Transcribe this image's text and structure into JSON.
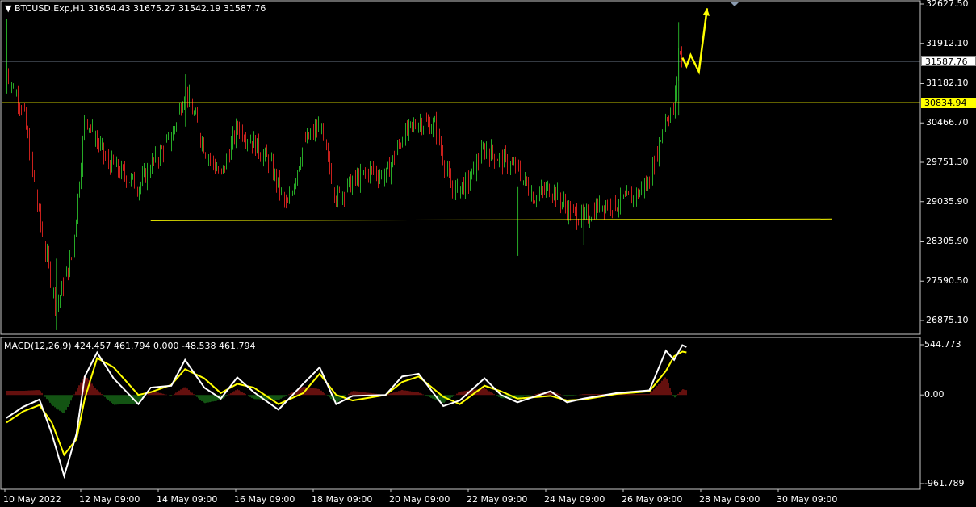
{
  "header": {
    "symbol_line": "BTCUSD.Exp,H1  31654.43 31675.27 31542.19 31587.76"
  },
  "price_axis": {
    "ticks": [
      "32627.50",
      "31912.10",
      "31182.10",
      "30466.70",
      "29751.30",
      "29035.90",
      "28305.90",
      "27590.50",
      "26875.10"
    ],
    "current_price": "31587.76",
    "level_price": "30834.94"
  },
  "macd_panel": {
    "title": "MACD(12,26,9) 424.457 461.794 0.000 -48.538 461.794",
    "ticks": [
      "544.773",
      "0.00",
      "-961.789"
    ]
  },
  "time_axis": {
    "labels": [
      "10 May 2022",
      "12 May 09:00",
      "14 May 09:00",
      "16 May 09:00",
      "18 May 09:00",
      "20 May 09:00",
      "22 May 09:00",
      "24 May 09:00",
      "26 May 09:00",
      "28 May 09:00",
      "30 May 09:00"
    ]
  },
  "colors": {
    "up_candle": "#26a826",
    "down_candle": "#c8201c",
    "macd_line": "#ffffff",
    "signal_line": "#ffff00",
    "current_price_line": "#8a9bb0",
    "level_line": "#ffff00",
    "arrow": "#ffff00",
    "grid_frame": "#c8c8c8"
  },
  "chart_data": [
    {
      "type": "candlestick",
      "title": "BTCUSD.Exp,H1",
      "ylim": [
        26600,
        32700
      ],
      "close_path": [
        {
          "x": "10 May 00:00",
          "y": 31400
        },
        {
          "x": "10 May 12:00",
          "y": 30700
        },
        {
          "x": "11 May 00:00",
          "y": 28700
        },
        {
          "x": "11 May 12:00",
          "y": 27100
        },
        {
          "x": "12 May 00:00",
          "y": 28100
        },
        {
          "x": "12 May 09:00",
          "y": 30600
        },
        {
          "x": "13 May 00:00",
          "y": 29800
        },
        {
          "x": "14 May 00:00",
          "y": 29300
        },
        {
          "x": "14 May 09:00",
          "y": 29700
        },
        {
          "x": "15 May 00:00",
          "y": 30200
        },
        {
          "x": "15 May 10:00",
          "y": 31100
        },
        {
          "x": "16 May 00:00",
          "y": 30000
        },
        {
          "x": "16 May 12:00",
          "y": 29500
        },
        {
          "x": "17 May 00:00",
          "y": 30400
        },
        {
          "x": "17 May 12:00",
          "y": 30100
        },
        {
          "x": "18 May 00:00",
          "y": 29700
        },
        {
          "x": "18 May 12:00",
          "y": 28900
        },
        {
          "x": "19 May 00:00",
          "y": 30100
        },
        {
          "x": "19 May 12:00",
          "y": 30400
        },
        {
          "x": "20 May 00:00",
          "y": 29100
        },
        {
          "x": "20 May 12:00",
          "y": 29400
        },
        {
          "x": "21 May 00:00",
          "y": 29600
        },
        {
          "x": "21 May 12:00",
          "y": 29500
        },
        {
          "x": "22 May 00:00",
          "y": 30200
        },
        {
          "x": "22 May 12:00",
          "y": 30500
        },
        {
          "x": "23 May 00:00",
          "y": 30400
        },
        {
          "x": "23 May 12:00",
          "y": 29200
        },
        {
          "x": "24 May 00:00",
          "y": 29400
        },
        {
          "x": "24 May 12:00",
          "y": 30000
        },
        {
          "x": "25 May 00:00",
          "y": 29800
        },
        {
          "x": "25 May 12:00",
          "y": 29600
        },
        {
          "x": "26 May 00:00",
          "y": 29100
        },
        {
          "x": "26 May 12:00",
          "y": 29300
        },
        {
          "x": "27 May 00:00",
          "y": 28900
        },
        {
          "x": "27 May 12:00",
          "y": 28700
        },
        {
          "x": "28 May 00:00",
          "y": 29000
        },
        {
          "x": "28 May 12:00",
          "y": 29000
        },
        {
          "x": "29 May 00:00",
          "y": 29100
        },
        {
          "x": "29 May 12:00",
          "y": 29400
        },
        {
          "x": "30 May 00:00",
          "y": 30600
        },
        {
          "x": "30 May 06:00",
          "y": 30700
        },
        {
          "x": "30 May 09:00",
          "y": 31800
        },
        {
          "x": "30 May 12:00",
          "y": 31587.76
        }
      ],
      "spikes": [
        {
          "x": "10 May 00:00",
          "high": 32350,
          "low": 31000
        },
        {
          "x": "11 May 12:00",
          "high": 28000,
          "low": 26700
        },
        {
          "x": "15 May 10:00",
          "high": 31350,
          "low": 30400
        },
        {
          "x": "25 May 12:00",
          "high": 29300,
          "low": 28050
        },
        {
          "x": "27 May 12:00",
          "high": 29000,
          "low": 28250
        },
        {
          "x": "30 May 09:00",
          "high": 32300,
          "low": 30600
        }
      ],
      "current_price": 31587.76,
      "horizontal_level": 30834.94,
      "support_trendline": [
        {
          "x": "14 May 09:00",
          "y": 28690
        },
        {
          "x": "31 May 09:00",
          "y": 28720
        }
      ],
      "projection_arrow": [
        {
          "x": "30 May 12:00",
          "y": 31650
        },
        {
          "x": "30 May 15:00",
          "y": 31500
        },
        {
          "x": "30 May 18:00",
          "y": 31700
        },
        {
          "x": "31 May 00:00",
          "y": 31400
        },
        {
          "x": "31 May 06:00",
          "y": 32550
        }
      ]
    },
    {
      "type": "macd",
      "title": "MACD(12,26,9)",
      "ylim": [
        -961.789,
        544.773
      ],
      "macd_line": [
        {
          "x": "10 May 00:00",
          "y": -250
        },
        {
          "x": "10 May 12:00",
          "y": -130
        },
        {
          "x": "11 May 00:00",
          "y": -50
        },
        {
          "x": "11 May 09:00",
          "y": -420
        },
        {
          "x": "11 May 18:00",
          "y": -880
        },
        {
          "x": "12 May 03:00",
          "y": -420
        },
        {
          "x": "12 May 09:00",
          "y": 200
        },
        {
          "x": "12 May 18:00",
          "y": 460
        },
        {
          "x": "13 May 06:00",
          "y": 180
        },
        {
          "x": "14 May 00:00",
          "y": -100
        },
        {
          "x": "14 May 09:00",
          "y": 80
        },
        {
          "x": "15 May 00:00",
          "y": 100
        },
        {
          "x": "15 May 10:00",
          "y": 380
        },
        {
          "x": "16 May 00:00",
          "y": 80
        },
        {
          "x": "16 May 12:00",
          "y": -40
        },
        {
          "x": "17 May 00:00",
          "y": 190
        },
        {
          "x": "17 May 12:00",
          "y": 30
        },
        {
          "x": "18 May 06:00",
          "y": -160
        },
        {
          "x": "19 May 00:00",
          "y": 120
        },
        {
          "x": "19 May 12:00",
          "y": 300
        },
        {
          "x": "20 May 00:00",
          "y": -100
        },
        {
          "x": "20 May 12:00",
          "y": -10
        },
        {
          "x": "21 May 12:00",
          "y": 0
        },
        {
          "x": "22 May 00:00",
          "y": 200
        },
        {
          "x": "22 May 12:00",
          "y": 230
        },
        {
          "x": "23 May 06:00",
          "y": -120
        },
        {
          "x": "23 May 18:00",
          "y": -60
        },
        {
          "x": "24 May 12:00",
          "y": 180
        },
        {
          "x": "25 May 00:00",
          "y": 0
        },
        {
          "x": "25 May 12:00",
          "y": -80
        },
        {
          "x": "26 May 12:00",
          "y": 40
        },
        {
          "x": "27 May 00:00",
          "y": -80
        },
        {
          "x": "27 May 12:00",
          "y": -40
        },
        {
          "x": "28 May 12:00",
          "y": 20
        },
        {
          "x": "29 May 12:00",
          "y": 50
        },
        {
          "x": "30 May 00:00",
          "y": 480
        },
        {
          "x": "30 May 06:00",
          "y": 380
        },
        {
          "x": "30 May 12:00",
          "y": 540
        },
        {
          "x": "30 May 15:00",
          "y": 520
        }
      ],
      "signal_line": [
        {
          "x": "10 May 00:00",
          "y": -300
        },
        {
          "x": "10 May 12:00",
          "y": -180
        },
        {
          "x": "11 May 00:00",
          "y": -110
        },
        {
          "x": "11 May 09:00",
          "y": -300
        },
        {
          "x": "11 May 18:00",
          "y": -650
        },
        {
          "x": "12 May 03:00",
          "y": -480
        },
        {
          "x": "12 May 09:00",
          "y": -40
        },
        {
          "x": "12 May 18:00",
          "y": 400
        },
        {
          "x": "13 May 06:00",
          "y": 300
        },
        {
          "x": "14 May 00:00",
          "y": 0
        },
        {
          "x": "14 May 09:00",
          "y": 30
        },
        {
          "x": "15 May 00:00",
          "y": 110
        },
        {
          "x": "15 May 10:00",
          "y": 280
        },
        {
          "x": "16 May 00:00",
          "y": 180
        },
        {
          "x": "16 May 12:00",
          "y": 20
        },
        {
          "x": "17 May 00:00",
          "y": 120
        },
        {
          "x": "17 May 12:00",
          "y": 80
        },
        {
          "x": "18 May 06:00",
          "y": -100
        },
        {
          "x": "19 May 00:00",
          "y": 20
        },
        {
          "x": "19 May 12:00",
          "y": 230
        },
        {
          "x": "20 May 00:00",
          "y": 0
        },
        {
          "x": "20 May 12:00",
          "y": -60
        },
        {
          "x": "21 May 12:00",
          "y": 0
        },
        {
          "x": "22 May 00:00",
          "y": 140
        },
        {
          "x": "22 May 12:00",
          "y": 200
        },
        {
          "x": "23 May 06:00",
          "y": -20
        },
        {
          "x": "23 May 18:00",
          "y": -100
        },
        {
          "x": "24 May 12:00",
          "y": 100
        },
        {
          "x": "25 May 00:00",
          "y": 40
        },
        {
          "x": "25 May 12:00",
          "y": -40
        },
        {
          "x": "26 May 12:00",
          "y": -10
        },
        {
          "x": "27 May 00:00",
          "y": -60
        },
        {
          "x": "27 May 12:00",
          "y": -50
        },
        {
          "x": "28 May 12:00",
          "y": 10
        },
        {
          "x": "29 May 12:00",
          "y": 40
        },
        {
          "x": "30 May 00:00",
          "y": 260
        },
        {
          "x": "30 May 06:00",
          "y": 420
        },
        {
          "x": "30 May 12:00",
          "y": 470
        },
        {
          "x": "30 May 15:00",
          "y": 461.794
        }
      ]
    }
  ]
}
